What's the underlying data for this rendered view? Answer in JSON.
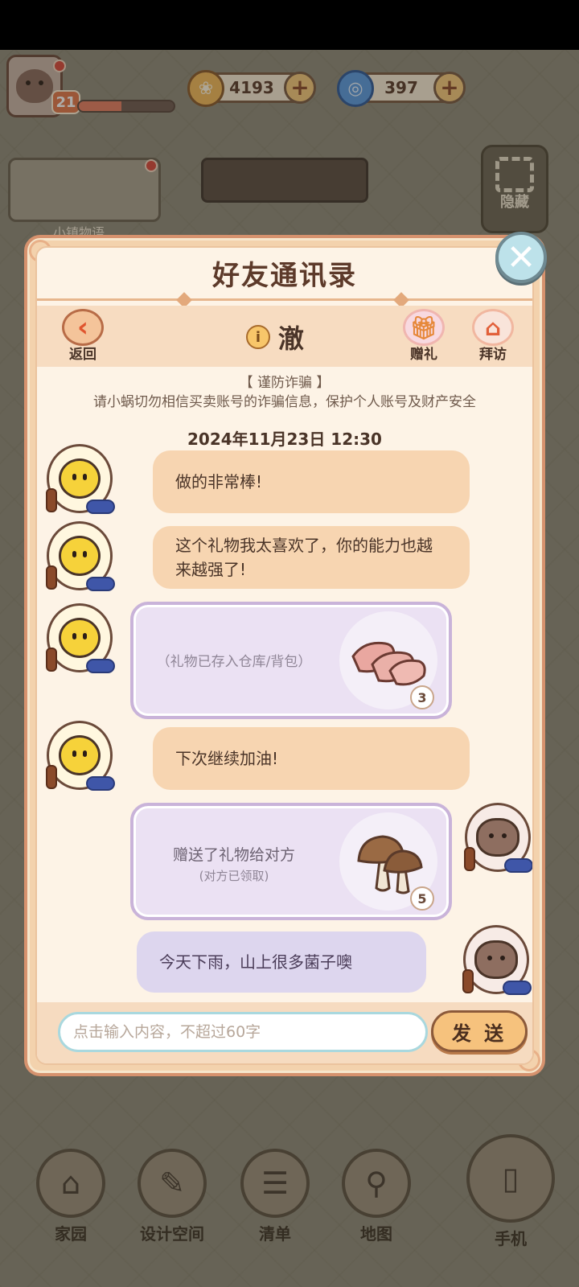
{
  "hud": {
    "level": "21",
    "exp_fraction": 0.45,
    "currency_coins": "4193",
    "currency_gems": "397",
    "bg_card_label": "小镇物语",
    "hide_label": "隐藏"
  },
  "dialog": {
    "title": "好友通讯录",
    "back_label": "返回",
    "friend_name": "澈",
    "gift_label": "赠礼",
    "visit_label": "拜访",
    "notice_title": "【 谨防诈骗 】",
    "notice_body": "请小蜗切勿相信买卖账号的诈骗信息，保护个人账号及财产安全",
    "timestamp": "2024年11月23日 12:30",
    "input_placeholder": "点击输入内容，不超过60字",
    "send_label": "发 送"
  },
  "messages": [
    {
      "side": "left",
      "type": "text",
      "text": "做的非常棒!"
    },
    {
      "side": "left",
      "type": "text",
      "text": "这个礼物我太喜欢了，你的能力也越来越强了!"
    },
    {
      "side": "left",
      "type": "gift",
      "text": "（礼物已存入仓库/背包）",
      "subtext": "",
      "item_icon": "bacon-icon",
      "count": "3"
    },
    {
      "side": "left",
      "type": "text",
      "text": "下次继续加油!"
    },
    {
      "side": "right",
      "type": "gift",
      "text": "赠送了礼物给对方",
      "subtext": "(对方已领取)",
      "item_icon": "mushroom-icon",
      "count": "5"
    },
    {
      "side": "right",
      "type": "text",
      "text": "今天下雨，山上很多菌子噢"
    }
  ],
  "bottom_nav": [
    {
      "label": "家园",
      "icon": "home-icon"
    },
    {
      "label": "设计空间",
      "icon": "design-icon"
    },
    {
      "label": "清单",
      "icon": "list-icon"
    },
    {
      "label": "地图",
      "icon": "map-pin-icon"
    },
    {
      "label": "手机",
      "icon": "phone-icon"
    }
  ],
  "colors": {
    "accent": "#e3764a",
    "bubble_left": "#f7d5b1",
    "bubble_right": "#ddd6ee",
    "dialog_border": "#d6926e"
  }
}
